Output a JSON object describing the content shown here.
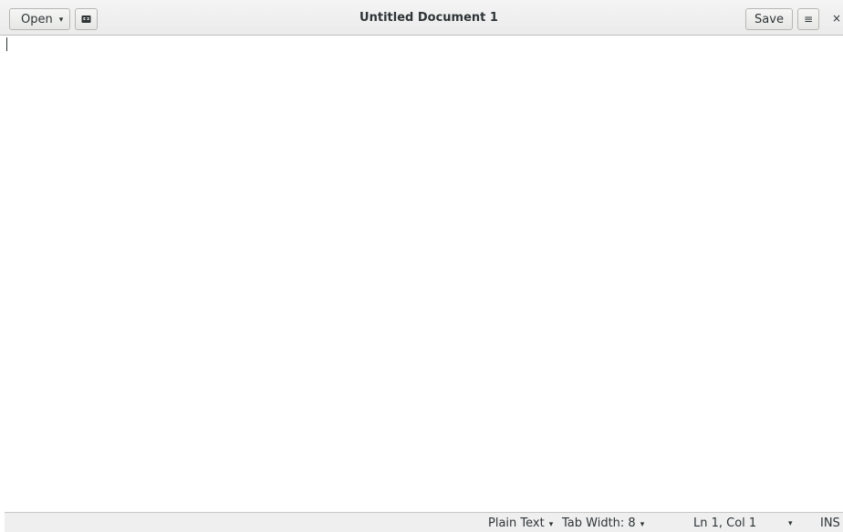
{
  "header": {
    "open_label": "Open",
    "open_caret": "▾",
    "new_tab_icon": "document-new-icon",
    "title": "Untitled Document 1",
    "save_label": "Save",
    "menu_glyph": "≡",
    "close_glyph": "×"
  },
  "editor": {
    "content": ""
  },
  "statusbar": {
    "language": "Plain Text",
    "tab_width": "Tab Width: 8",
    "position": "Ln 1, Col 1",
    "mode": "INS",
    "caret": "▾"
  },
  "colors": {
    "header_bg": "#ebebeb",
    "text": "#2e3436",
    "statusbar_bg": "#efefef"
  }
}
